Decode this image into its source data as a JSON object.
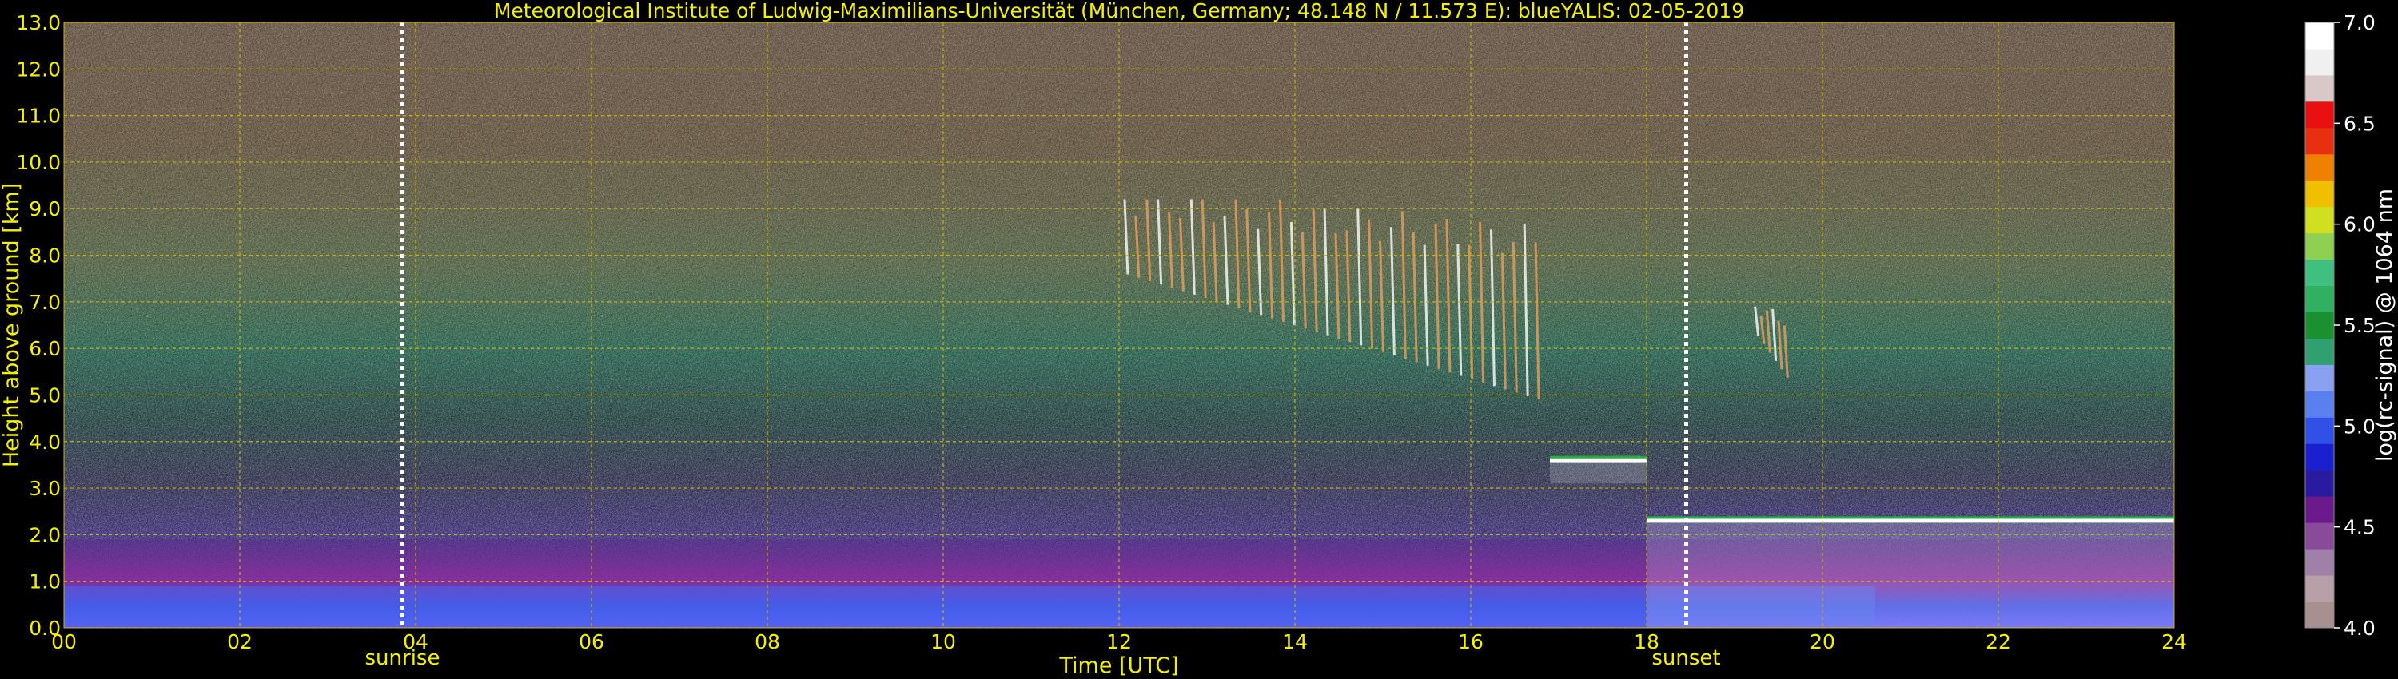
{
  "chart_data": {
    "type": "heatmap",
    "title": "Meteorological Institute of Ludwig-Maximilians-Universität (München, Germany; 48.148 N / 11.573 E):    blueYALIS: 02-05-2019",
    "xlabel": "Time [UTC]",
    "ylabel": "Height above ground [km]",
    "xlim": [
      0,
      24
    ],
    "ylim": [
      0,
      13
    ],
    "x_ticks": [
      "00",
      "02",
      "04",
      "06",
      "08",
      "10",
      "12",
      "14",
      "16",
      "18",
      "20",
      "22",
      "24"
    ],
    "y_ticks": [
      "0.0",
      "1.0",
      "2.0",
      "3.0",
      "4.0",
      "5.0",
      "6.0",
      "7.0",
      "8.0",
      "9.0",
      "10.0",
      "11.0",
      "12.0",
      "13.0"
    ],
    "grid": true,
    "markers": [
      {
        "label": "sunrise",
        "x": 3.85
      },
      {
        "label": "sunset",
        "x": 18.45
      }
    ],
    "colorbar": {
      "label": "log(rc-signal) @ 1064 nm",
      "range": [
        4.0,
        7.0
      ],
      "ticks": [
        "4.0",
        "4.5",
        "5.0",
        "5.5",
        "6.0",
        "6.5",
        "7.0"
      ],
      "colors": [
        "#a89090",
        "#b8a0a8",
        "#a080a8",
        "#8a4a9a",
        "#6a1a8a",
        "#2a1aa0",
        "#1a20d0",
        "#3050e8",
        "#5a80f0",
        "#8aa0f0",
        "#30a070",
        "#1a9030",
        "#30b060",
        "#40c080",
        "#90d050",
        "#d0e020",
        "#f0c000",
        "#f08000",
        "#e83010",
        "#e81010",
        "#d8c8c8",
        "#f0f0f0",
        "#ffffff"
      ]
    },
    "features": [
      {
        "name": "boundary layer aerosol",
        "x": [
          0,
          24
        ],
        "y": [
          0,
          1.9
        ]
      },
      {
        "name": "cirrus",
        "x": [
          12.0,
          16.8
        ],
        "y": [
          4.6,
          9.2
        ]
      },
      {
        "name": "cirrus",
        "x": [
          19.2,
          19.6
        ],
        "y": [
          5.1,
          6.9
        ]
      },
      {
        "name": "low cloud",
        "x": [
          16.9,
          18.0
        ],
        "y": [
          3.1,
          3.6
        ]
      },
      {
        "name": "low cloud",
        "x": [
          18.0,
          24.0
        ],
        "y": [
          0.0,
          2.3
        ]
      }
    ]
  },
  "colors": {
    "background": "#000000",
    "text": "#f5f000",
    "grid": "#c8b400",
    "marker": "#ffffff"
  }
}
